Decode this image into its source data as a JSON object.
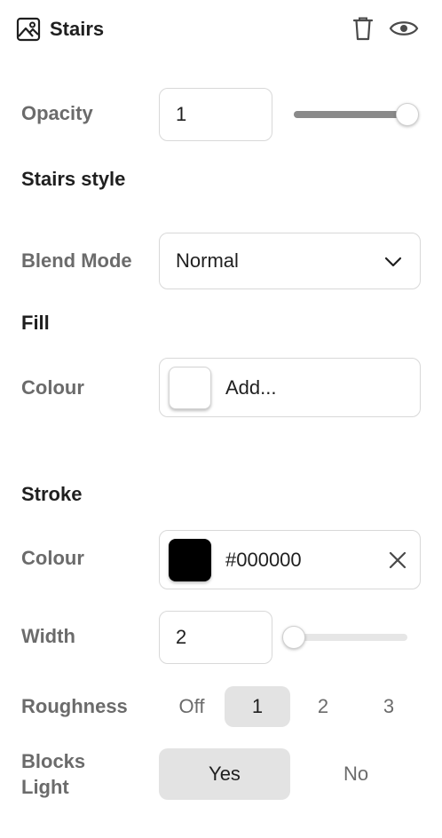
{
  "header": {
    "title": "Stairs",
    "image_icon": "image-icon",
    "delete_icon": "trash-icon",
    "visibility_icon": "eye-icon"
  },
  "opacity": {
    "label": "Opacity",
    "value": "1",
    "slider_fraction": 1.0
  },
  "style_section": {
    "title": "Stairs style"
  },
  "blend_mode": {
    "label": "Blend Mode",
    "value": "Normal",
    "chevron_icon": "chevron-down-icon"
  },
  "fill": {
    "title": "Fill",
    "colour_label": "Colour",
    "colour_value": "Add...",
    "swatch_color": "#ffffff"
  },
  "stroke": {
    "title": "Stroke",
    "colour_label": "Colour",
    "colour_value": "#000000",
    "swatch_color": "#000000",
    "clear_icon": "close-icon",
    "width_label": "Width",
    "width_value": "2",
    "width_slider_fraction": 0.0
  },
  "roughness": {
    "label": "Roughness",
    "options": [
      "Off",
      "1",
      "2",
      "3"
    ],
    "selected": "1"
  },
  "blocks_light": {
    "label_line1": "Blocks",
    "label_line2": "Light",
    "options": [
      "Yes",
      "No"
    ],
    "selected": "Yes"
  }
}
